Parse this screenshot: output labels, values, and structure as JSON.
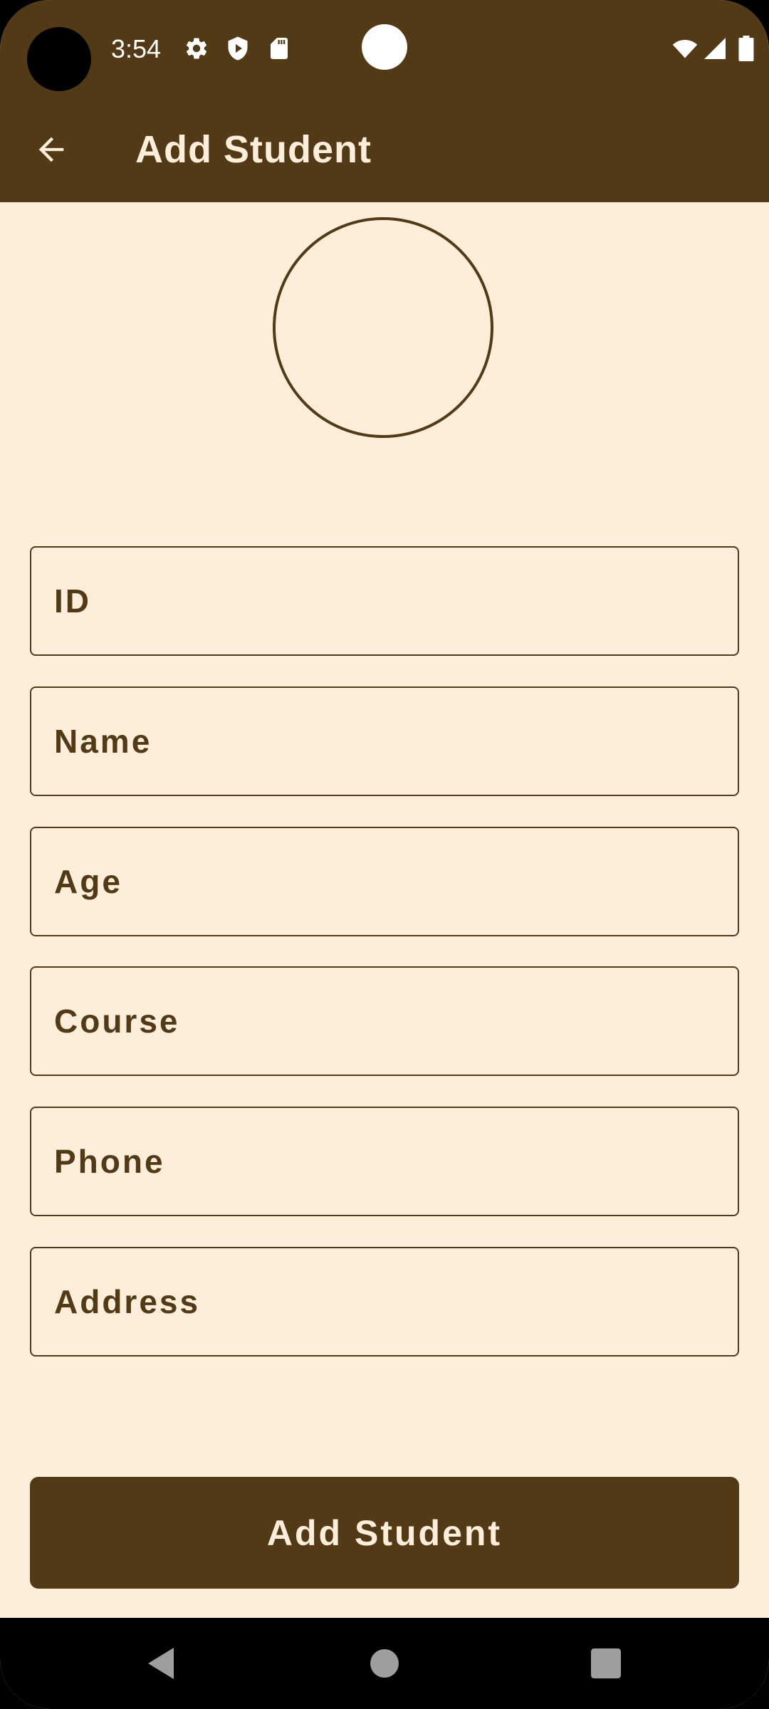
{
  "status_bar": {
    "time": "3:54",
    "left_icons": [
      "gear-icon",
      "shield-play-icon",
      "sd-card-icon"
    ],
    "right_icons": [
      "wifi-icon",
      "signal-icon",
      "battery-icon"
    ]
  },
  "app_bar": {
    "title": "Add Student",
    "back_icon": "arrow-back-icon"
  },
  "form": {
    "fields": [
      {
        "name": "id",
        "placeholder": "ID",
        "value": ""
      },
      {
        "name": "name",
        "placeholder": "Name",
        "value": ""
      },
      {
        "name": "age",
        "placeholder": "Age",
        "value": ""
      },
      {
        "name": "course",
        "placeholder": "Course",
        "value": ""
      },
      {
        "name": "phone",
        "placeholder": "Phone",
        "value": ""
      },
      {
        "name": "address",
        "placeholder": "Address",
        "value": ""
      }
    ],
    "submit_label": "Add Student"
  },
  "nav_bar": {
    "buttons": [
      "back-triangle-icon",
      "home-circle-icon",
      "recents-square-icon"
    ]
  },
  "colors": {
    "primary": "#533A17",
    "background": "#FCEEDA",
    "on_primary": "#FCEEDA",
    "status_icons": "#FFFFFF",
    "nav_icons": "#9E9E9E"
  }
}
